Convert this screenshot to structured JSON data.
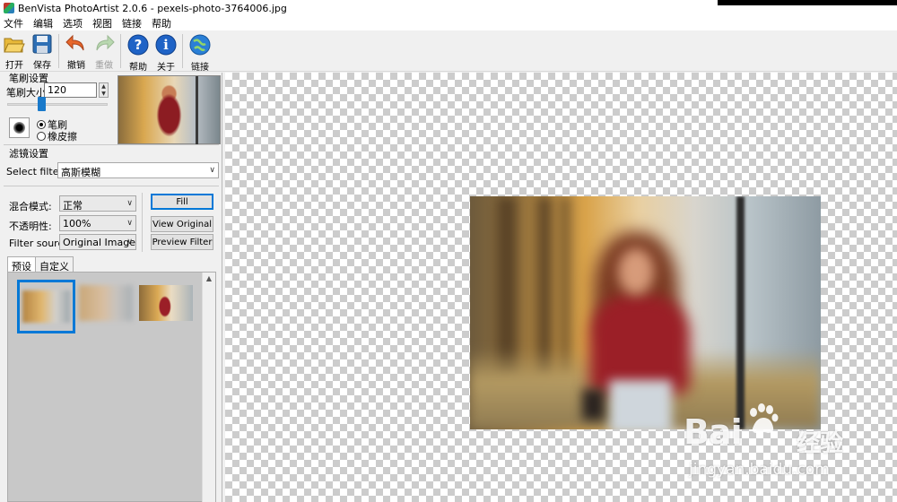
{
  "window": {
    "title": "BenVista PhotoArtist 2.0.6 - pexels-photo-3764006.jpg"
  },
  "menu": [
    "文件",
    "编辑",
    "选项",
    "视图",
    "链接",
    "帮助"
  ],
  "toolbar": {
    "open": "打开",
    "save": "保存",
    "undo": "撤销",
    "redo": "重做",
    "help": "帮助",
    "about": "关于",
    "link": "链接"
  },
  "brush_settings": {
    "title": "笔刷设置",
    "size_label": "笔刷大小:",
    "size_value": "120",
    "mode_brush": "笔刷",
    "mode_eraser": "橡皮擦",
    "selected_mode": "笔刷"
  },
  "filter_settings": {
    "title": "滤镜设置",
    "select_filter_label": "Select filter:",
    "select_filter_value": "高斯模糊",
    "blend_mode_label": "混合模式:",
    "blend_mode_value": "正常",
    "opacity_label": "不透明性:",
    "opacity_value": "100%",
    "filter_source_label": "Filter source:",
    "filter_source_value": "Original Image",
    "fill_button": "Fill",
    "view_original_button": "View Original",
    "preview_filter_button": "Preview Filter"
  },
  "tabs": [
    "预设",
    "自定义"
  ],
  "active_tab": "预设",
  "watermark": {
    "brand": "Bai",
    "brand2": "经验",
    "url": "jingyan.baidu.com"
  },
  "colors": {
    "accent": "#0078d7",
    "slider": "#1979ca"
  }
}
